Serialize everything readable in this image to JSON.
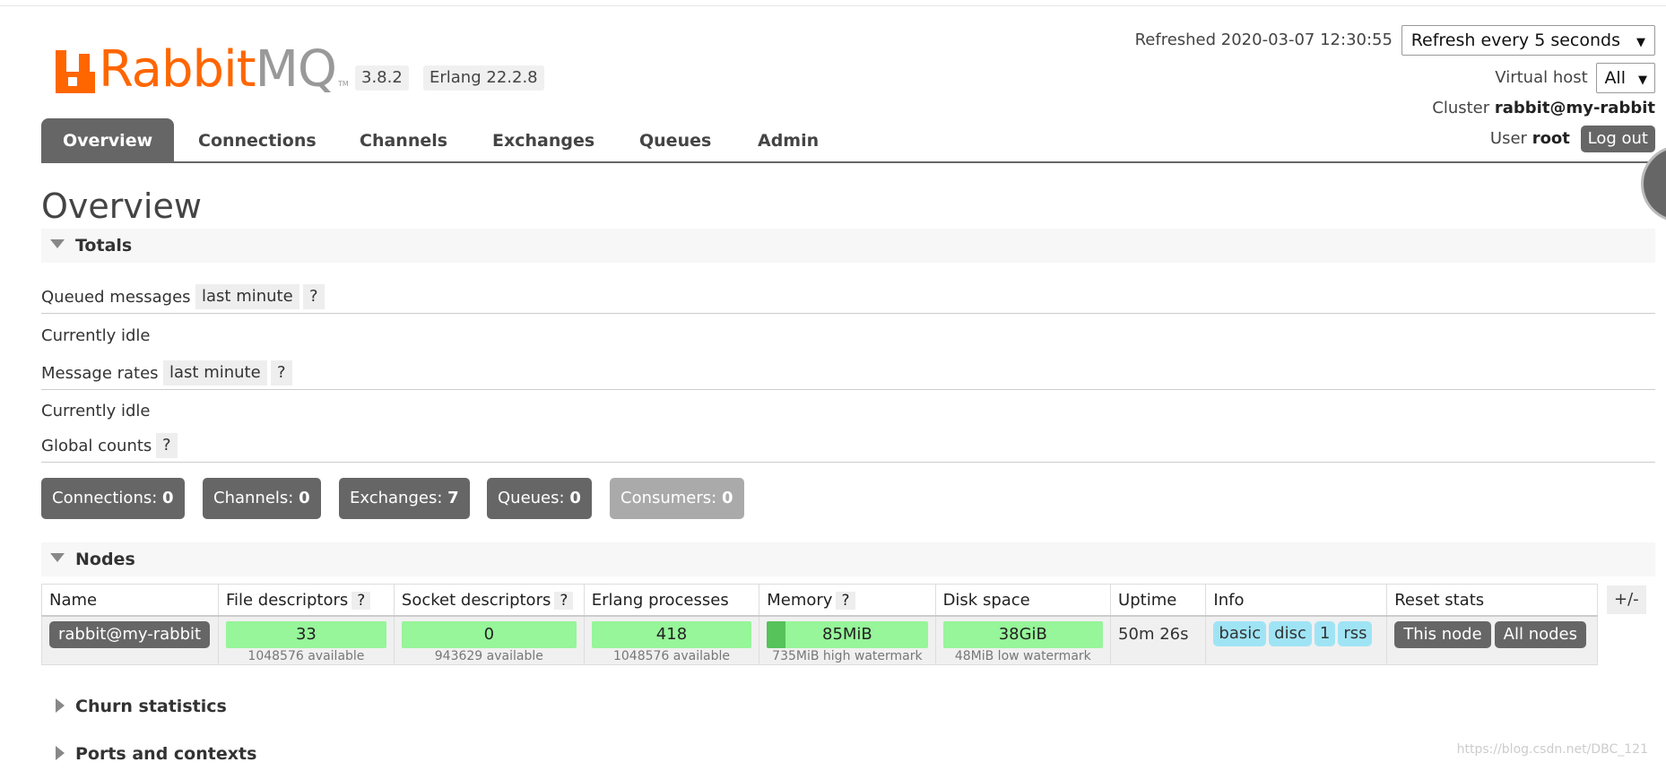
{
  "logo": {
    "rabbit": "Rabbit",
    "mq": "MQ",
    "tm": "TM"
  },
  "versions": {
    "rabbitmq": "3.8.2",
    "erlang": "Erlang 22.2.8"
  },
  "header": {
    "refreshed": "Refreshed 2020-03-07 12:30:55",
    "refresh_select": "Refresh every 5 seconds",
    "virtual_host_label": "Virtual host",
    "virtual_host_value": "All",
    "cluster_label": "Cluster",
    "cluster_value": "rabbit@my-rabbit",
    "user_label": "User",
    "user_value": "root",
    "logout_label": "Log out"
  },
  "tabs": [
    {
      "label": "Overview",
      "active": true
    },
    {
      "label": "Connections"
    },
    {
      "label": "Channels"
    },
    {
      "label": "Exchanges"
    },
    {
      "label": "Queues"
    },
    {
      "label": "Admin"
    }
  ],
  "page_title": "Overview",
  "totals": {
    "heading": "Totals",
    "queued_messages_label": "Queued messages",
    "queued_messages_range": "last minute",
    "queued_idle": "Currently idle",
    "message_rates_label": "Message rates",
    "message_rates_range": "last minute",
    "rates_idle": "Currently idle",
    "global_counts_label": "Global counts",
    "help": "?"
  },
  "counts": [
    {
      "label": "Connections:",
      "value": "0"
    },
    {
      "label": "Channels:",
      "value": "0"
    },
    {
      "label": "Exchanges:",
      "value": "7"
    },
    {
      "label": "Queues:",
      "value": "0"
    },
    {
      "label": "Consumers:",
      "value": "0"
    }
  ],
  "nodes": {
    "heading": "Nodes",
    "plus_minus": "+/-",
    "columns": [
      "Name",
      "File descriptors",
      "Socket descriptors",
      "Erlang processes",
      "Memory",
      "Disk space",
      "Uptime",
      "Info",
      "Reset stats"
    ],
    "row": {
      "name": "rabbit@my-rabbit",
      "fd_value": "33",
      "fd_sub": "1048576 available",
      "sd_value": "0",
      "sd_sub": "943629 available",
      "ep_value": "418",
      "ep_sub": "1048576 available",
      "mem_value": "85MiB",
      "mem_sub": "735MiB high watermark",
      "mem_fraction": 0.116,
      "disk_value": "38GiB",
      "disk_sub": "48MiB low watermark",
      "uptime": "50m 26s",
      "info": [
        "basic",
        "disc",
        "1",
        "rss"
      ],
      "reset_this": "This node",
      "reset_all": "All nodes"
    }
  },
  "churn": {
    "heading": "Churn statistics"
  },
  "ports": {
    "heading": "Ports and contexts"
  },
  "watermark": "https://blog.csdn.net/DBC_121",
  "colors": {
    "accent": "#ff6600",
    "bar_green": "#97f59a",
    "info_blue": "#9fe4f5",
    "dark_gray": "#666666"
  }
}
